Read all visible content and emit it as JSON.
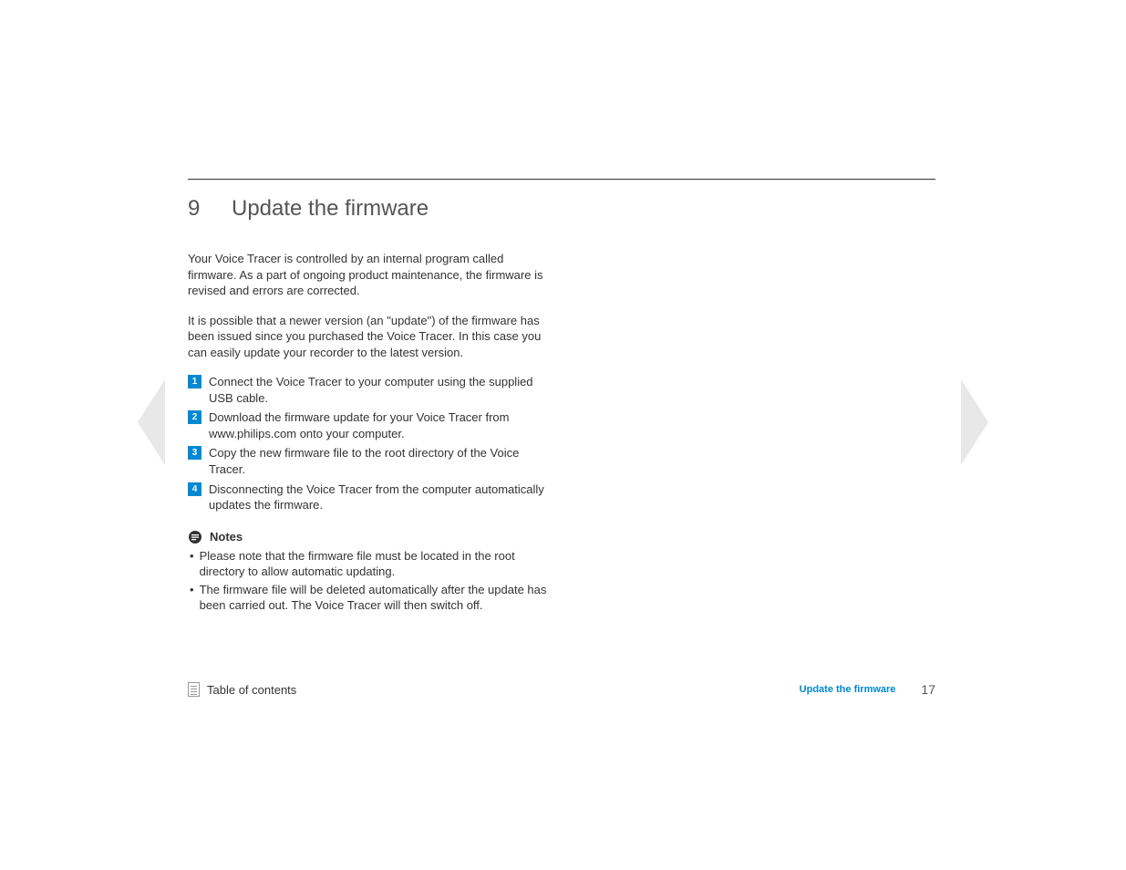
{
  "chapter": {
    "number": "9",
    "title": "Update the firmware"
  },
  "paragraphs": [
    "Your Voice Tracer is controlled by an internal program called firmware. As a part of ongoing product maintenance, the firmware is revised and errors are corrected.",
    "It is possible that a newer version (an \"update\") of the firmware has been issued since you purchased the Voice Tracer. In this case you can easily update your recorder to the latest version."
  ],
  "steps": [
    {
      "num": "1",
      "text": "Connect the Voice Tracer to your computer using the supplied USB cable."
    },
    {
      "num": "2",
      "text": "Download the firmware update for your Voice Tracer from www.philips.com onto your computer."
    },
    {
      "num": "3",
      "text": "Copy the new firmware file to the root directory of the Voice Tracer."
    },
    {
      "num": "4",
      "text": "Disconnecting the Voice Tracer from the computer automatically updates the firmware."
    }
  ],
  "notes": {
    "title": "Notes",
    "items": [
      "Please note that the firmware file must be located in the root directory to allow automatic updating.",
      "The firmware file will be deleted automatically after the update has been carried out. The Voice Tracer will then switch off."
    ]
  },
  "footer": {
    "toc_label": "Table of contents",
    "section_link": "Update the firmware",
    "page_number": "17"
  }
}
